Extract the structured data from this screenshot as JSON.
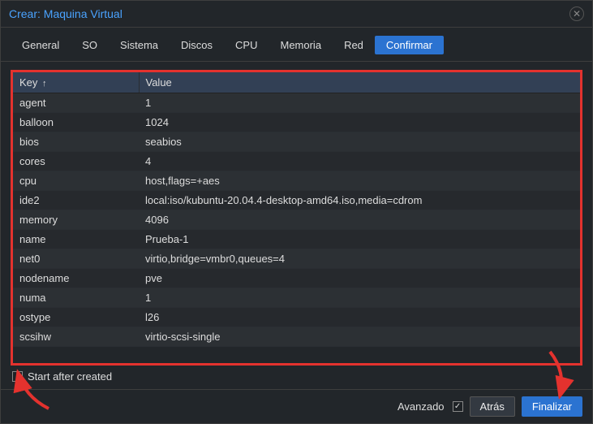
{
  "title": "Crear: Maquina Virtual",
  "tabs": [
    "General",
    "SO",
    "Sistema",
    "Discos",
    "CPU",
    "Memoria",
    "Red",
    "Confirmar"
  ],
  "active_tab": "Confirmar",
  "table": {
    "header_key": "Key",
    "header_value": "Value",
    "sort_indicator": "↑",
    "rows": [
      {
        "k": "agent",
        "v": "1"
      },
      {
        "k": "balloon",
        "v": "1024"
      },
      {
        "k": "bios",
        "v": "seabios"
      },
      {
        "k": "cores",
        "v": "4"
      },
      {
        "k": "cpu",
        "v": "host,flags=+aes"
      },
      {
        "k": "ide2",
        "v": "local:iso/kubuntu-20.04.4-desktop-amd64.iso,media=cdrom"
      },
      {
        "k": "memory",
        "v": "4096"
      },
      {
        "k": "name",
        "v": "Prueba-1"
      },
      {
        "k": "net0",
        "v": "virtio,bridge=vmbr0,queues=4"
      },
      {
        "k": "nodename",
        "v": "pve"
      },
      {
        "k": "numa",
        "v": "1"
      },
      {
        "k": "ostype",
        "v": "l26"
      },
      {
        "k": "scsihw",
        "v": "virtio-scsi-single"
      }
    ]
  },
  "start_after_created": {
    "label": "Start after created",
    "checked": false
  },
  "footer": {
    "advanced_label": "Avanzado",
    "advanced_checked": true,
    "back_label": "Atrás",
    "finish_label": "Finalizar"
  }
}
